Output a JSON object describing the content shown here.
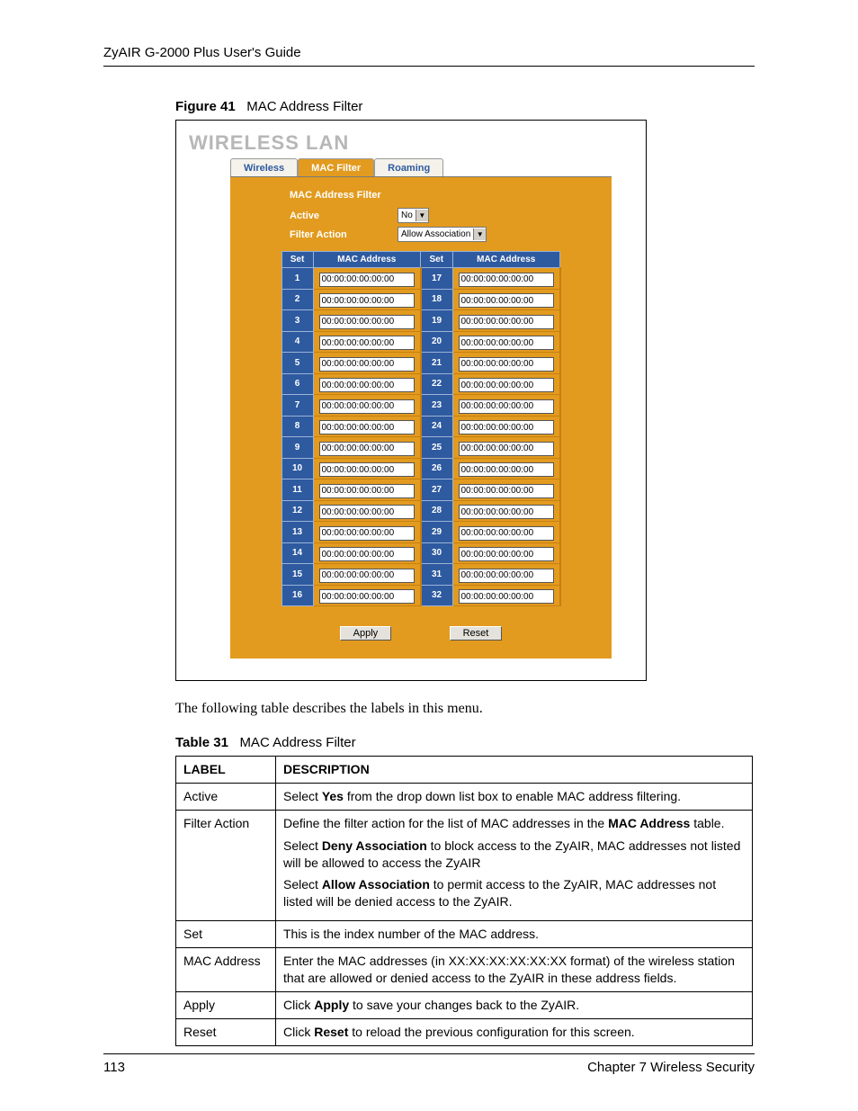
{
  "header": {
    "title": "ZyAIR G-2000 Plus User's Guide"
  },
  "figure": {
    "label": "Figure 41",
    "caption": "MAC Address Filter"
  },
  "wlan": {
    "title": "WIRELESS LAN",
    "tabs": {
      "wireless": "Wireless",
      "macfilter": "MAC Filter",
      "roaming": "Roaming"
    },
    "section_title": "MAC Address Filter",
    "active_label": "Active",
    "active_value": "No",
    "filter_action_label": "Filter Action",
    "filter_action_value": "Allow Association",
    "th_set": "Set",
    "th_mac": "MAC Address",
    "rows_left": [
      {
        "set": "1",
        "mac": "00:00:00:00:00:00"
      },
      {
        "set": "2",
        "mac": "00:00:00:00:00:00"
      },
      {
        "set": "3",
        "mac": "00:00:00:00:00:00"
      },
      {
        "set": "4",
        "mac": "00:00:00:00:00:00"
      },
      {
        "set": "5",
        "mac": "00:00:00:00:00:00"
      },
      {
        "set": "6",
        "mac": "00:00:00:00:00:00"
      },
      {
        "set": "7",
        "mac": "00:00:00:00:00:00"
      },
      {
        "set": "8",
        "mac": "00:00:00:00:00:00"
      },
      {
        "set": "9",
        "mac": "00:00:00:00:00:00"
      },
      {
        "set": "10",
        "mac": "00:00:00:00:00:00"
      },
      {
        "set": "11",
        "mac": "00:00:00:00:00:00"
      },
      {
        "set": "12",
        "mac": "00:00:00:00:00:00"
      },
      {
        "set": "13",
        "mac": "00:00:00:00:00:00"
      },
      {
        "set": "14",
        "mac": "00:00:00:00:00:00"
      },
      {
        "set": "15",
        "mac": "00:00:00:00:00:00"
      },
      {
        "set": "16",
        "mac": "00:00:00:00:00:00"
      }
    ],
    "rows_right": [
      {
        "set": "17",
        "mac": "00:00:00:00:00:00"
      },
      {
        "set": "18",
        "mac": "00:00:00:00:00:00"
      },
      {
        "set": "19",
        "mac": "00:00:00:00:00:00"
      },
      {
        "set": "20",
        "mac": "00:00:00:00:00:00"
      },
      {
        "set": "21",
        "mac": "00:00:00:00:00:00"
      },
      {
        "set": "22",
        "mac": "00:00:00:00:00:00"
      },
      {
        "set": "23",
        "mac": "00:00:00:00:00:00"
      },
      {
        "set": "24",
        "mac": "00:00:00:00:00:00"
      },
      {
        "set": "25",
        "mac": "00:00:00:00:00:00"
      },
      {
        "set": "26",
        "mac": "00:00:00:00:00:00"
      },
      {
        "set": "27",
        "mac": "00:00:00:00:00:00"
      },
      {
        "set": "28",
        "mac": "00:00:00:00:00:00"
      },
      {
        "set": "29",
        "mac": "00:00:00:00:00:00"
      },
      {
        "set": "30",
        "mac": "00:00:00:00:00:00"
      },
      {
        "set": "31",
        "mac": "00:00:00:00:00:00"
      },
      {
        "set": "32",
        "mac": "00:00:00:00:00:00"
      }
    ],
    "apply": "Apply",
    "reset": "Reset"
  },
  "body_text": "The following table describes the labels in this menu.",
  "table": {
    "label": "Table 31",
    "caption": "MAC Address Filter",
    "th_label": "LABEL",
    "th_desc": "DESCRIPTION",
    "rows": {
      "active": {
        "label": "Active"
      },
      "filter_action": {
        "label": "Filter Action"
      },
      "set": {
        "label": "Set",
        "desc": "This is the index number of the MAC address."
      },
      "mac": {
        "label": "MAC Address",
        "desc": "Enter the MAC addresses (in XX:XX:XX:XX:XX:XX format) of the wireless station that are allowed or denied access to the ZyAIR in these address fields."
      },
      "apply": {
        "label": "Apply"
      },
      "reset": {
        "label": "Reset"
      }
    }
  },
  "footer": {
    "page": "113",
    "chapter": "Chapter 7 Wireless Security"
  }
}
